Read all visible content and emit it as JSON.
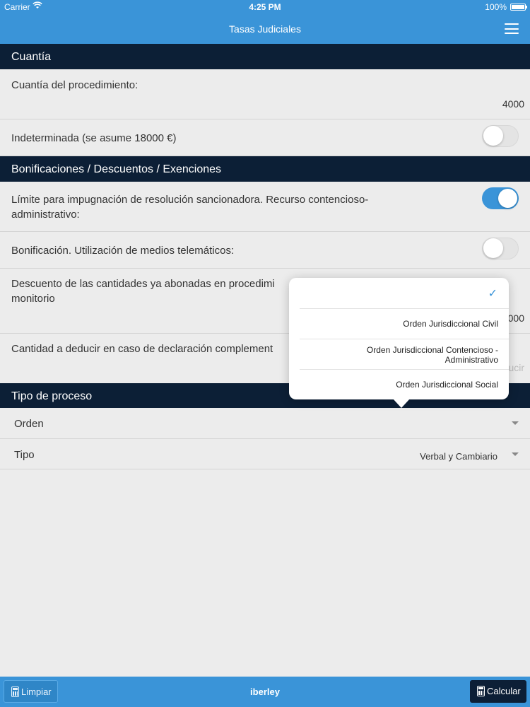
{
  "status_bar": {
    "carrier": "Carrier",
    "time": "4:25 PM",
    "battery": "100%"
  },
  "nav": {
    "title": "Tasas Judiciales"
  },
  "sections": {
    "cuantia": "Cuantía",
    "bonificaciones": "Bonificaciones / Descuentos / Exenciones",
    "tipo_proceso": "Tipo de proceso"
  },
  "cuantia": {
    "procedimiento_label": "Cuantía del procedimiento:",
    "procedimiento_value": "4000",
    "indeterminada_label": "Indeterminada (se asume 18000 €)",
    "indeterminada_on": false
  },
  "bonificaciones": {
    "limite_label_line1": "Límite para impugnación de resolución sancionadora. Recurso contencioso-",
    "limite_label_line2": "administrativo:",
    "limite_on": true,
    "telematicos_label": "Bonificación. Utilización de medios telemáticos:",
    "telematicos_on": false,
    "descuento_label_line1": "Descuento de las cantidades ya abonadas en procedimi",
    "descuento_label_line2": "monitorio",
    "descuento_value_partial": "000",
    "deducir_label": "Cantidad a deducir en caso de declaración complement",
    "deducir_placeholder_partial": "ucir"
  },
  "tipo_proceso": {
    "orden_label": "Orden",
    "orden_value": "",
    "tipo_label": "Tipo",
    "tipo_value": "Verbal y Cambiario"
  },
  "popover": {
    "selected_index": 0,
    "options": [
      "",
      "Orden Jurisdiccional Civil",
      "Orden Jurisdiccional Contencioso - Administrativo",
      "Orden Jurisdiccional Social"
    ],
    "option2_line1": "Orden Jurisdiccional Contencioso -",
    "option2_line2": "Administrativo"
  },
  "bottom_bar": {
    "clear_label": "Limpiar",
    "brand": "iberley",
    "calculate_label": "Calcular"
  },
  "colors": {
    "accent": "#3a94d8",
    "header_dark": "#0c1f36",
    "background": "#ececec"
  }
}
